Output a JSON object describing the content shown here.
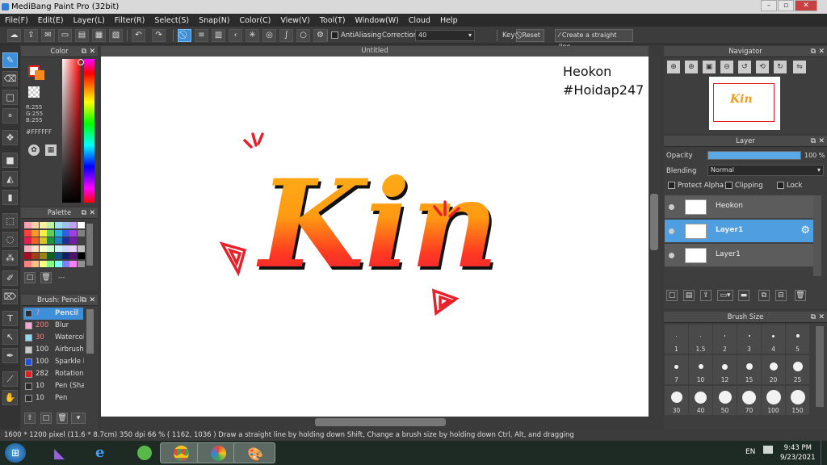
{
  "window": {
    "title": "MediBang Paint Pro (32bit)",
    "min_label": "–",
    "max_label": "▫",
    "close_label": "✕"
  },
  "menu": [
    "File(F)",
    "Edit(E)",
    "Layer(L)",
    "Filter(R)",
    "Select(S)",
    "Snap(N)",
    "Color(C)",
    "View(V)",
    "Tool(T)",
    "Window(W)",
    "Cloud",
    "Help"
  ],
  "toolbar": {
    "antialias_label": "AntiAliasing",
    "correction_label": "Correction",
    "correction_value": "40",
    "key_label": "Key",
    "reset_label": "Reset",
    "straight_label": "Create a straight line"
  },
  "document": {
    "tab_title": "Untitled"
  },
  "canvas": {
    "watermark_line1": "Heokon",
    "watermark_line2": "#Hoidap247",
    "art_text": "Kin"
  },
  "color_panel": {
    "title": "Color",
    "r": "R:255",
    "g": "G:255",
    "b": "B:255",
    "hex": "#FFFFFF",
    "fg": "#ffffff",
    "bg": "#e8201f"
  },
  "palette_panel": {
    "title": "Palette",
    "footer": "---"
  },
  "brush_panel": {
    "title": "Brush: Pencil",
    "items": [
      {
        "size": "7",
        "name": "Pencil",
        "color": "#2c2f3a"
      },
      {
        "size": "200",
        "name": "Blur",
        "color": "#f7a8d8"
      },
      {
        "size": "30",
        "name": "Watercolor",
        "color": "#8fd7f5"
      },
      {
        "size": "100",
        "name": "Airbrush",
        "color": "#c9c9c9"
      },
      {
        "size": "100",
        "name": "Sparkle B",
        "color": "#2050e0"
      },
      {
        "size": "282",
        "name": "Rotation",
        "color": "#e02020"
      },
      {
        "size": "10",
        "name": "Pen (Sha",
        "color": "#2c2c2c"
      },
      {
        "size": "10",
        "name": "Pen",
        "color": "#2c2c2c"
      }
    ]
  },
  "navigator": {
    "title": "Navigator"
  },
  "layer_panel": {
    "title": "Layer",
    "opacity_label": "Opacity",
    "opacity_value": "100 %",
    "opacity_level": 1.0,
    "blending_label": "Blending",
    "blending_value": "Normal",
    "protect_alpha": "Protect Alpha",
    "clipping": "Clipping",
    "lock": "Lock",
    "layers": [
      {
        "name": "Heokon",
        "selected": false
      },
      {
        "name": "Layer1",
        "selected": true
      },
      {
        "name": "Layer1",
        "selected": false
      }
    ]
  },
  "brush_size_panel": {
    "title": "Brush Size",
    "sizes": [
      "1",
      "1.5",
      "2",
      "3",
      "4",
      "5",
      "7",
      "10",
      "12",
      "15",
      "20",
      "25",
      "30",
      "40",
      "50",
      "70",
      "100",
      "150"
    ]
  },
  "status": {
    "text": "1600 * 1200 pixel   (11.6 * 8.7cm)   350 dpi   66 %   ( 1162, 1036 )   Draw a straight line by holding down Shift, Change a brush size by holding down Ctrl, Alt, and dragging"
  },
  "taskbar": {
    "lang": "EN",
    "time": "9:43 PM",
    "date": "9/23/2021"
  }
}
